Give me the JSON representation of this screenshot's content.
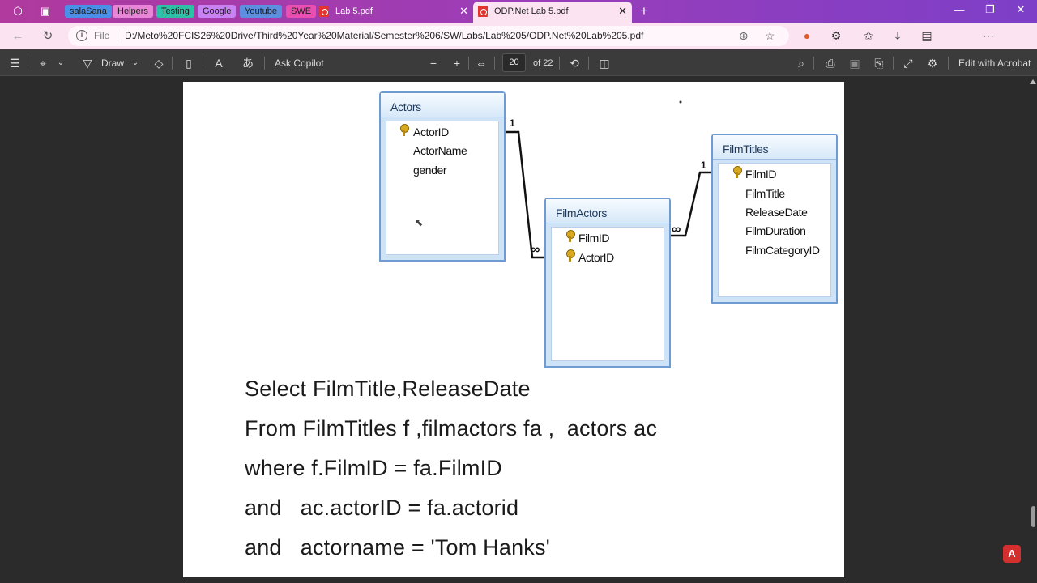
{
  "tab_groups": [
    {
      "label": "salaSana",
      "color": "#4a8fe8"
    },
    {
      "label": "Helpers",
      "color": "#e985d6"
    },
    {
      "label": "Testing",
      "color": "#2fbfa4"
    },
    {
      "label": "Google",
      "color": "#c982f3"
    },
    {
      "label": "Youtube",
      "color": "#5c8fe0"
    },
    {
      "label": "SWE",
      "color": "#e84fb0"
    }
  ],
  "tabs": [
    {
      "title": "Lab 5.pdf",
      "active": false
    },
    {
      "title": "ODP.Net Lab 5.pdf",
      "active": true
    }
  ],
  "address": {
    "protocol": "File",
    "url": "D:/Meto%20FCIS26%20Drive/Third%20Year%20Material/Semester%206/SW/Labs/Lab%205/ODP.Net%20Lab%205.pdf"
  },
  "pdf_toolbar": {
    "draw_label": "Draw",
    "ask_copilot_label": "Ask Copilot",
    "page_number": "20",
    "page_total": "of 22",
    "edit_label": "Edit with Acrobat"
  },
  "diagram": {
    "actors": {
      "title": "Actors",
      "fields": [
        "ActorID",
        "ActorName",
        "gender"
      ]
    },
    "filmactors": {
      "title": "FilmActors",
      "fields": [
        "FilmID",
        "ActorID"
      ]
    },
    "filmtitles": {
      "title": "FilmTitles",
      "fields": [
        "FilmID",
        "FilmTitle",
        "ReleaseDate",
        "FilmDuration",
        "FilmCategoryID"
      ]
    },
    "one_label": "1",
    "many_label": "∞"
  },
  "sql_lines": [
    "Select FilmTitle,ReleaseDate",
    "From FilmTitles f ,filmactors fa ,  actors ac",
    "where f.FilmID = fa.FilmID",
    "and   ac.actorID = fa.actorid",
    "and   actorname = 'Tom Hanks'"
  ]
}
